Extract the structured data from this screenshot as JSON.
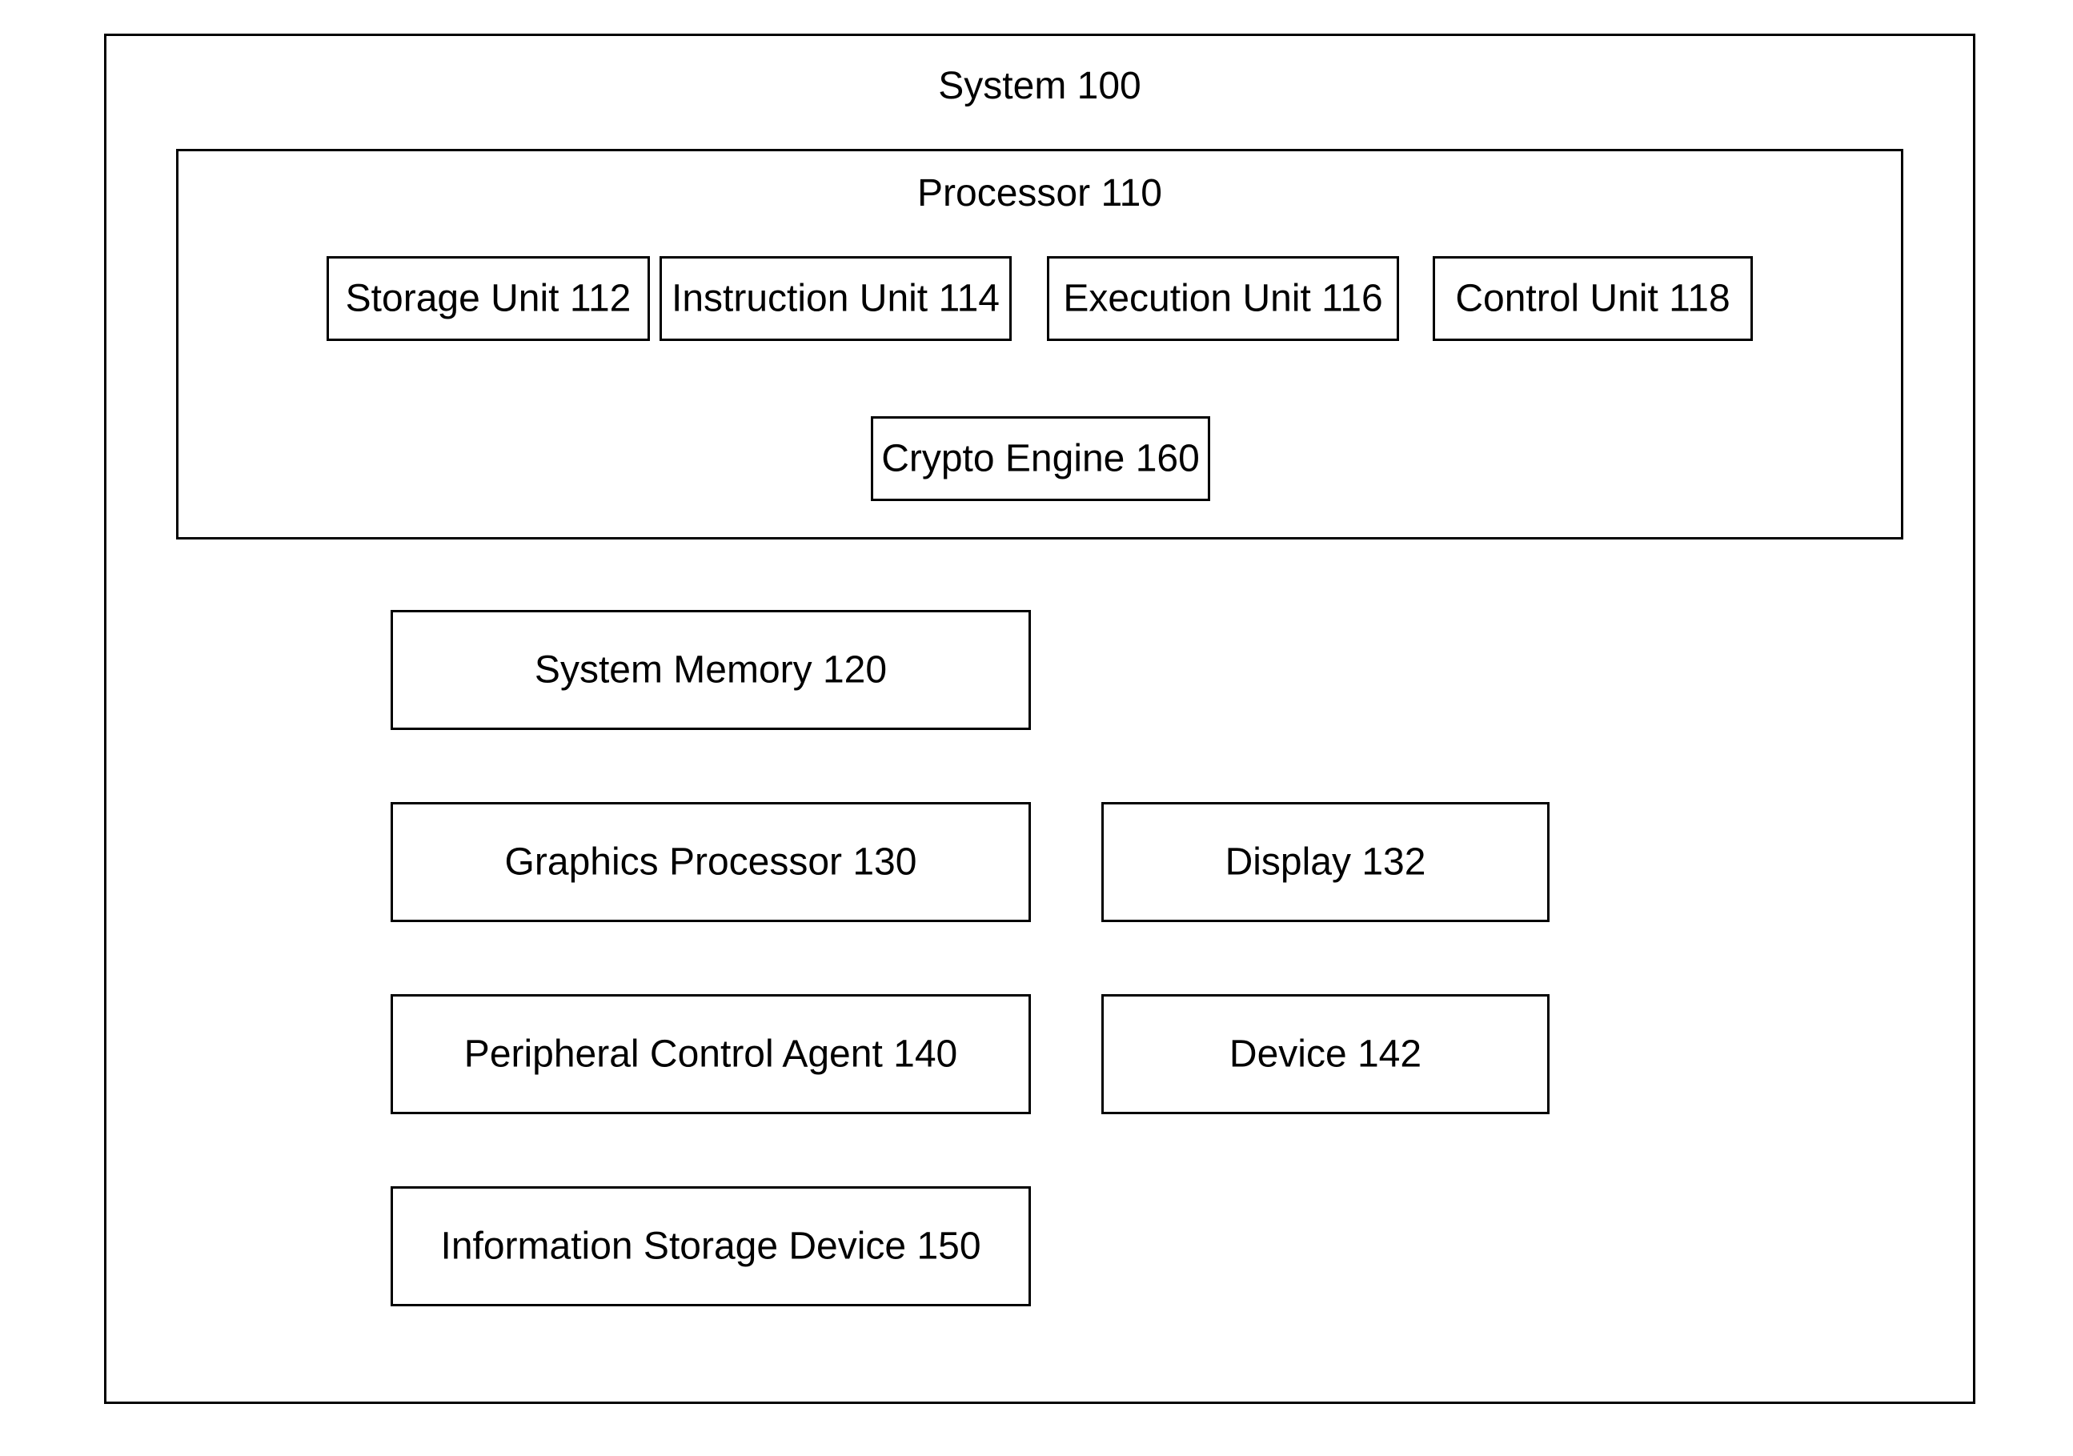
{
  "system": {
    "title": "System 100",
    "processor": {
      "title": "Processor 110",
      "units": {
        "storage": "Storage Unit 112",
        "instruction": "Instruction Unit 114",
        "execution": "Execution Unit 116",
        "control": "Control Unit 118"
      },
      "crypto": "Crypto Engine 160"
    },
    "memory": "System Memory 120",
    "graphics": "Graphics Processor 130",
    "display": "Display 132",
    "peripheral": "Peripheral Control Agent 140",
    "device": "Device 142",
    "storage_device": "Information Storage Device 150"
  }
}
